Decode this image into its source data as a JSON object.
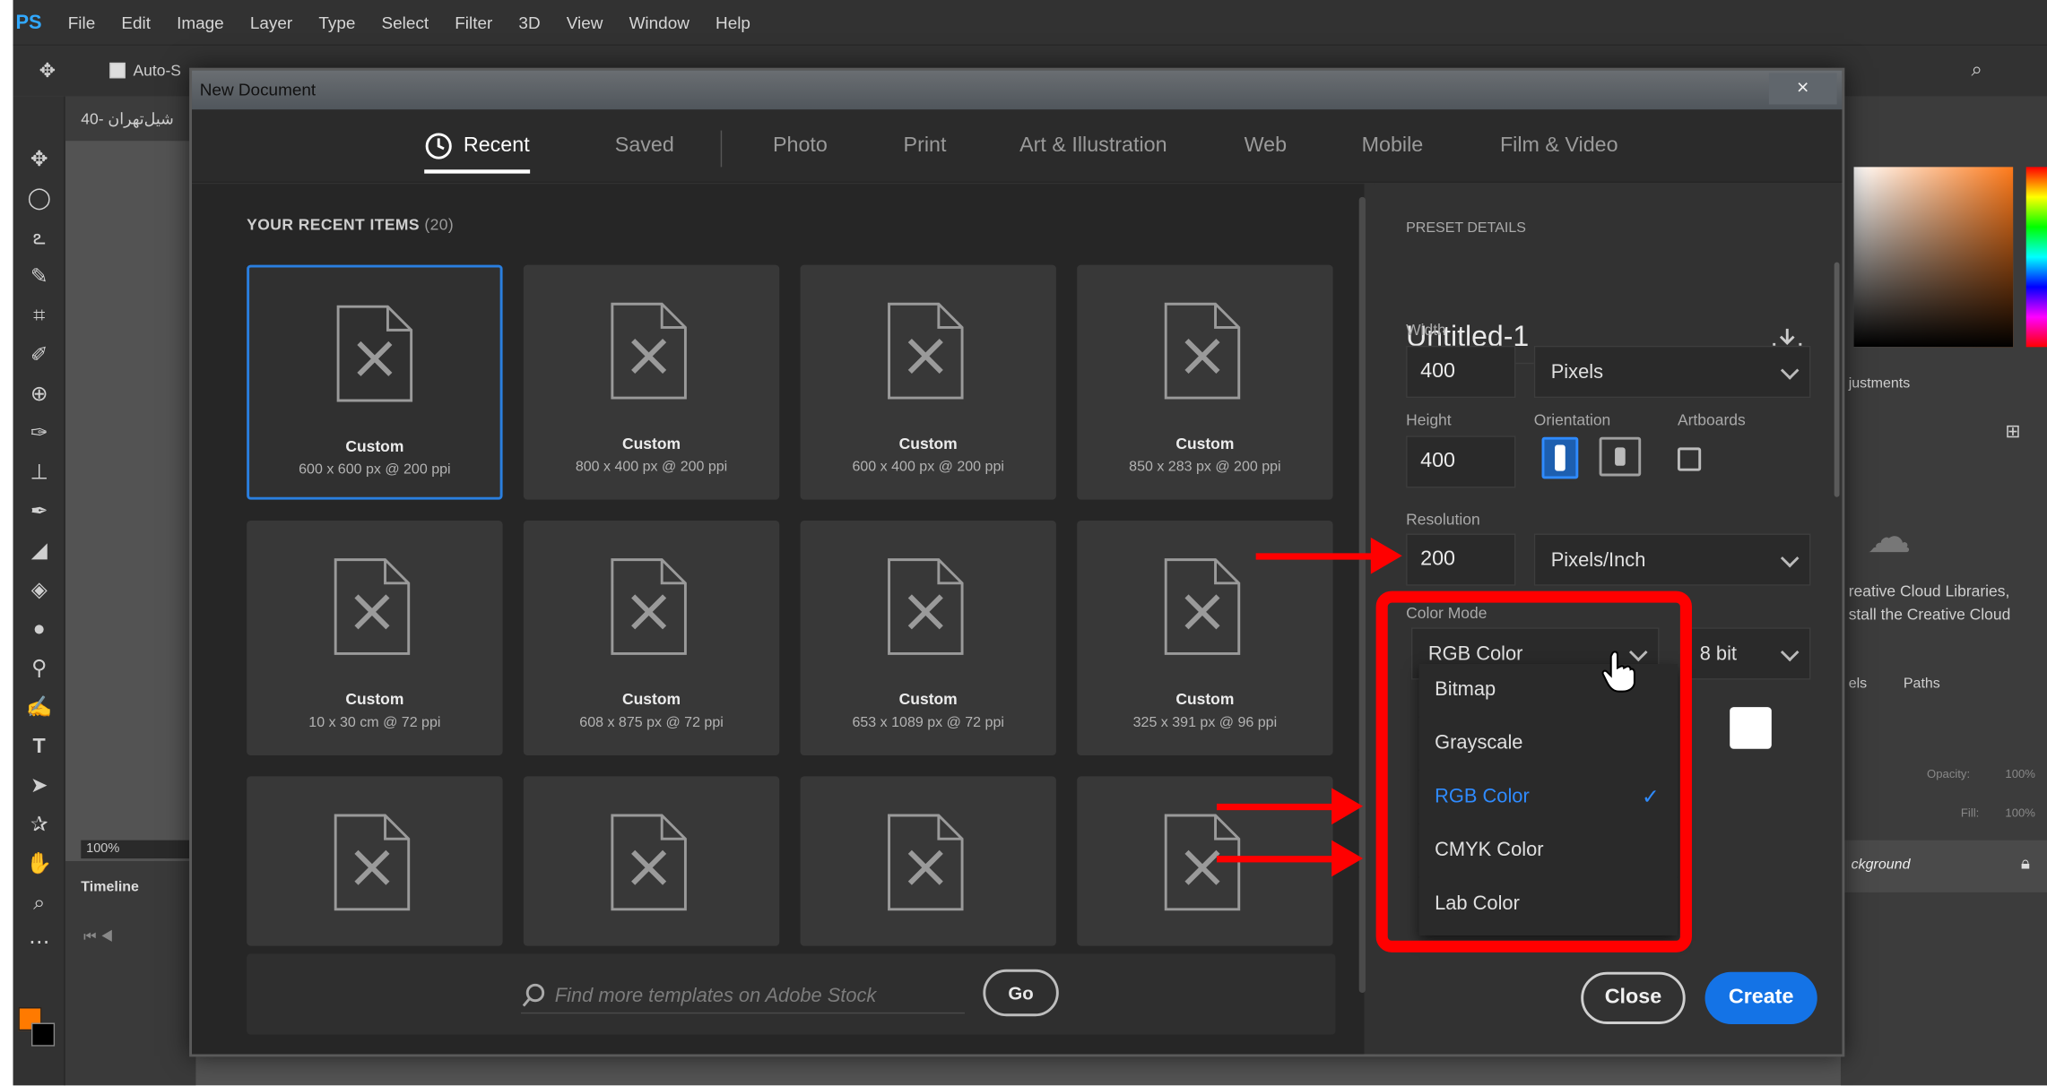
{
  "app": {
    "logo": "PS",
    "menu": [
      "File",
      "Edit",
      "Image",
      "Layer",
      "Type",
      "Select",
      "Filter",
      "3D",
      "View",
      "Window",
      "Help"
    ],
    "options_autoselect": "Auto-S",
    "doc_tab": "40- شيل‌تهران",
    "zoom": "100%",
    "timeline": "Timeline",
    "panels": {
      "adjustments": "justments",
      "paths_tab": "Paths",
      "layers_tab": "els",
      "cc_text_1": "reative Cloud Libraries,",
      "cc_text_2": "stall the Creative Cloud",
      "layer_name": "ckground",
      "opacity_label": "Opacity:",
      "opacity_value": "100%",
      "fill_label": "Fill:",
      "fill_value": "100%"
    }
  },
  "dialog": {
    "title": "New Document",
    "close_glyph": "×",
    "tabs": [
      {
        "label": "Recent"
      },
      {
        "label": "Saved"
      },
      {
        "label": "Photo"
      },
      {
        "label": "Print"
      },
      {
        "label": "Art & Illustration"
      },
      {
        "label": "Web"
      },
      {
        "label": "Mobile"
      },
      {
        "label": "Film & Video"
      }
    ],
    "recent": {
      "heading": "YOUR RECENT ITEMS",
      "count": "(20)",
      "items": [
        {
          "name": "Custom",
          "size": "600 x 600 px @ 200 ppi"
        },
        {
          "name": "Custom",
          "size": "800 x 400 px @ 200 ppi"
        },
        {
          "name": "Custom",
          "size": "600 x 400 px @ 200 ppi"
        },
        {
          "name": "Custom",
          "size": "850 x 283 px @ 200 ppi"
        },
        {
          "name": "Custom",
          "size": "10 x 30 cm @ 72 ppi"
        },
        {
          "name": "Custom",
          "size": "608 x 875 px @ 72 ppi"
        },
        {
          "name": "Custom",
          "size": "653 x 1089 px @ 72 ppi"
        },
        {
          "name": "Custom",
          "size": "325 x 391 px @ 96 ppi"
        }
      ]
    },
    "search": {
      "placeholder": "Find more templates on Adobe Stock",
      "go": "Go"
    },
    "preset": {
      "heading": "PRESET DETAILS",
      "name": "Untitled-1",
      "width_label": "Width",
      "width_value": "400",
      "width_unit": "Pixels",
      "height_label": "Height",
      "height_value": "400",
      "orientation_label": "Orientation",
      "artboards_label": "Artboards",
      "resolution_label": "Resolution",
      "resolution_value": "200",
      "resolution_unit": "Pixels/Inch",
      "color_mode_label": "Color Mode",
      "color_mode_value": "RGB Color",
      "bit_depth": "8 bit",
      "color_mode_options": [
        {
          "label": "Bitmap"
        },
        {
          "label": "Grayscale"
        },
        {
          "label": "RGB Color",
          "check": "✓"
        },
        {
          "label": "CMYK Color"
        },
        {
          "label": "Lab Color"
        }
      ]
    },
    "buttons": {
      "close": "Close",
      "create": "Create"
    }
  },
  "colors": {
    "accent": "#1473e6",
    "selected": "#2f8bff",
    "annotation": "#ff0000",
    "foreground_swatch": "#ff7a00"
  }
}
